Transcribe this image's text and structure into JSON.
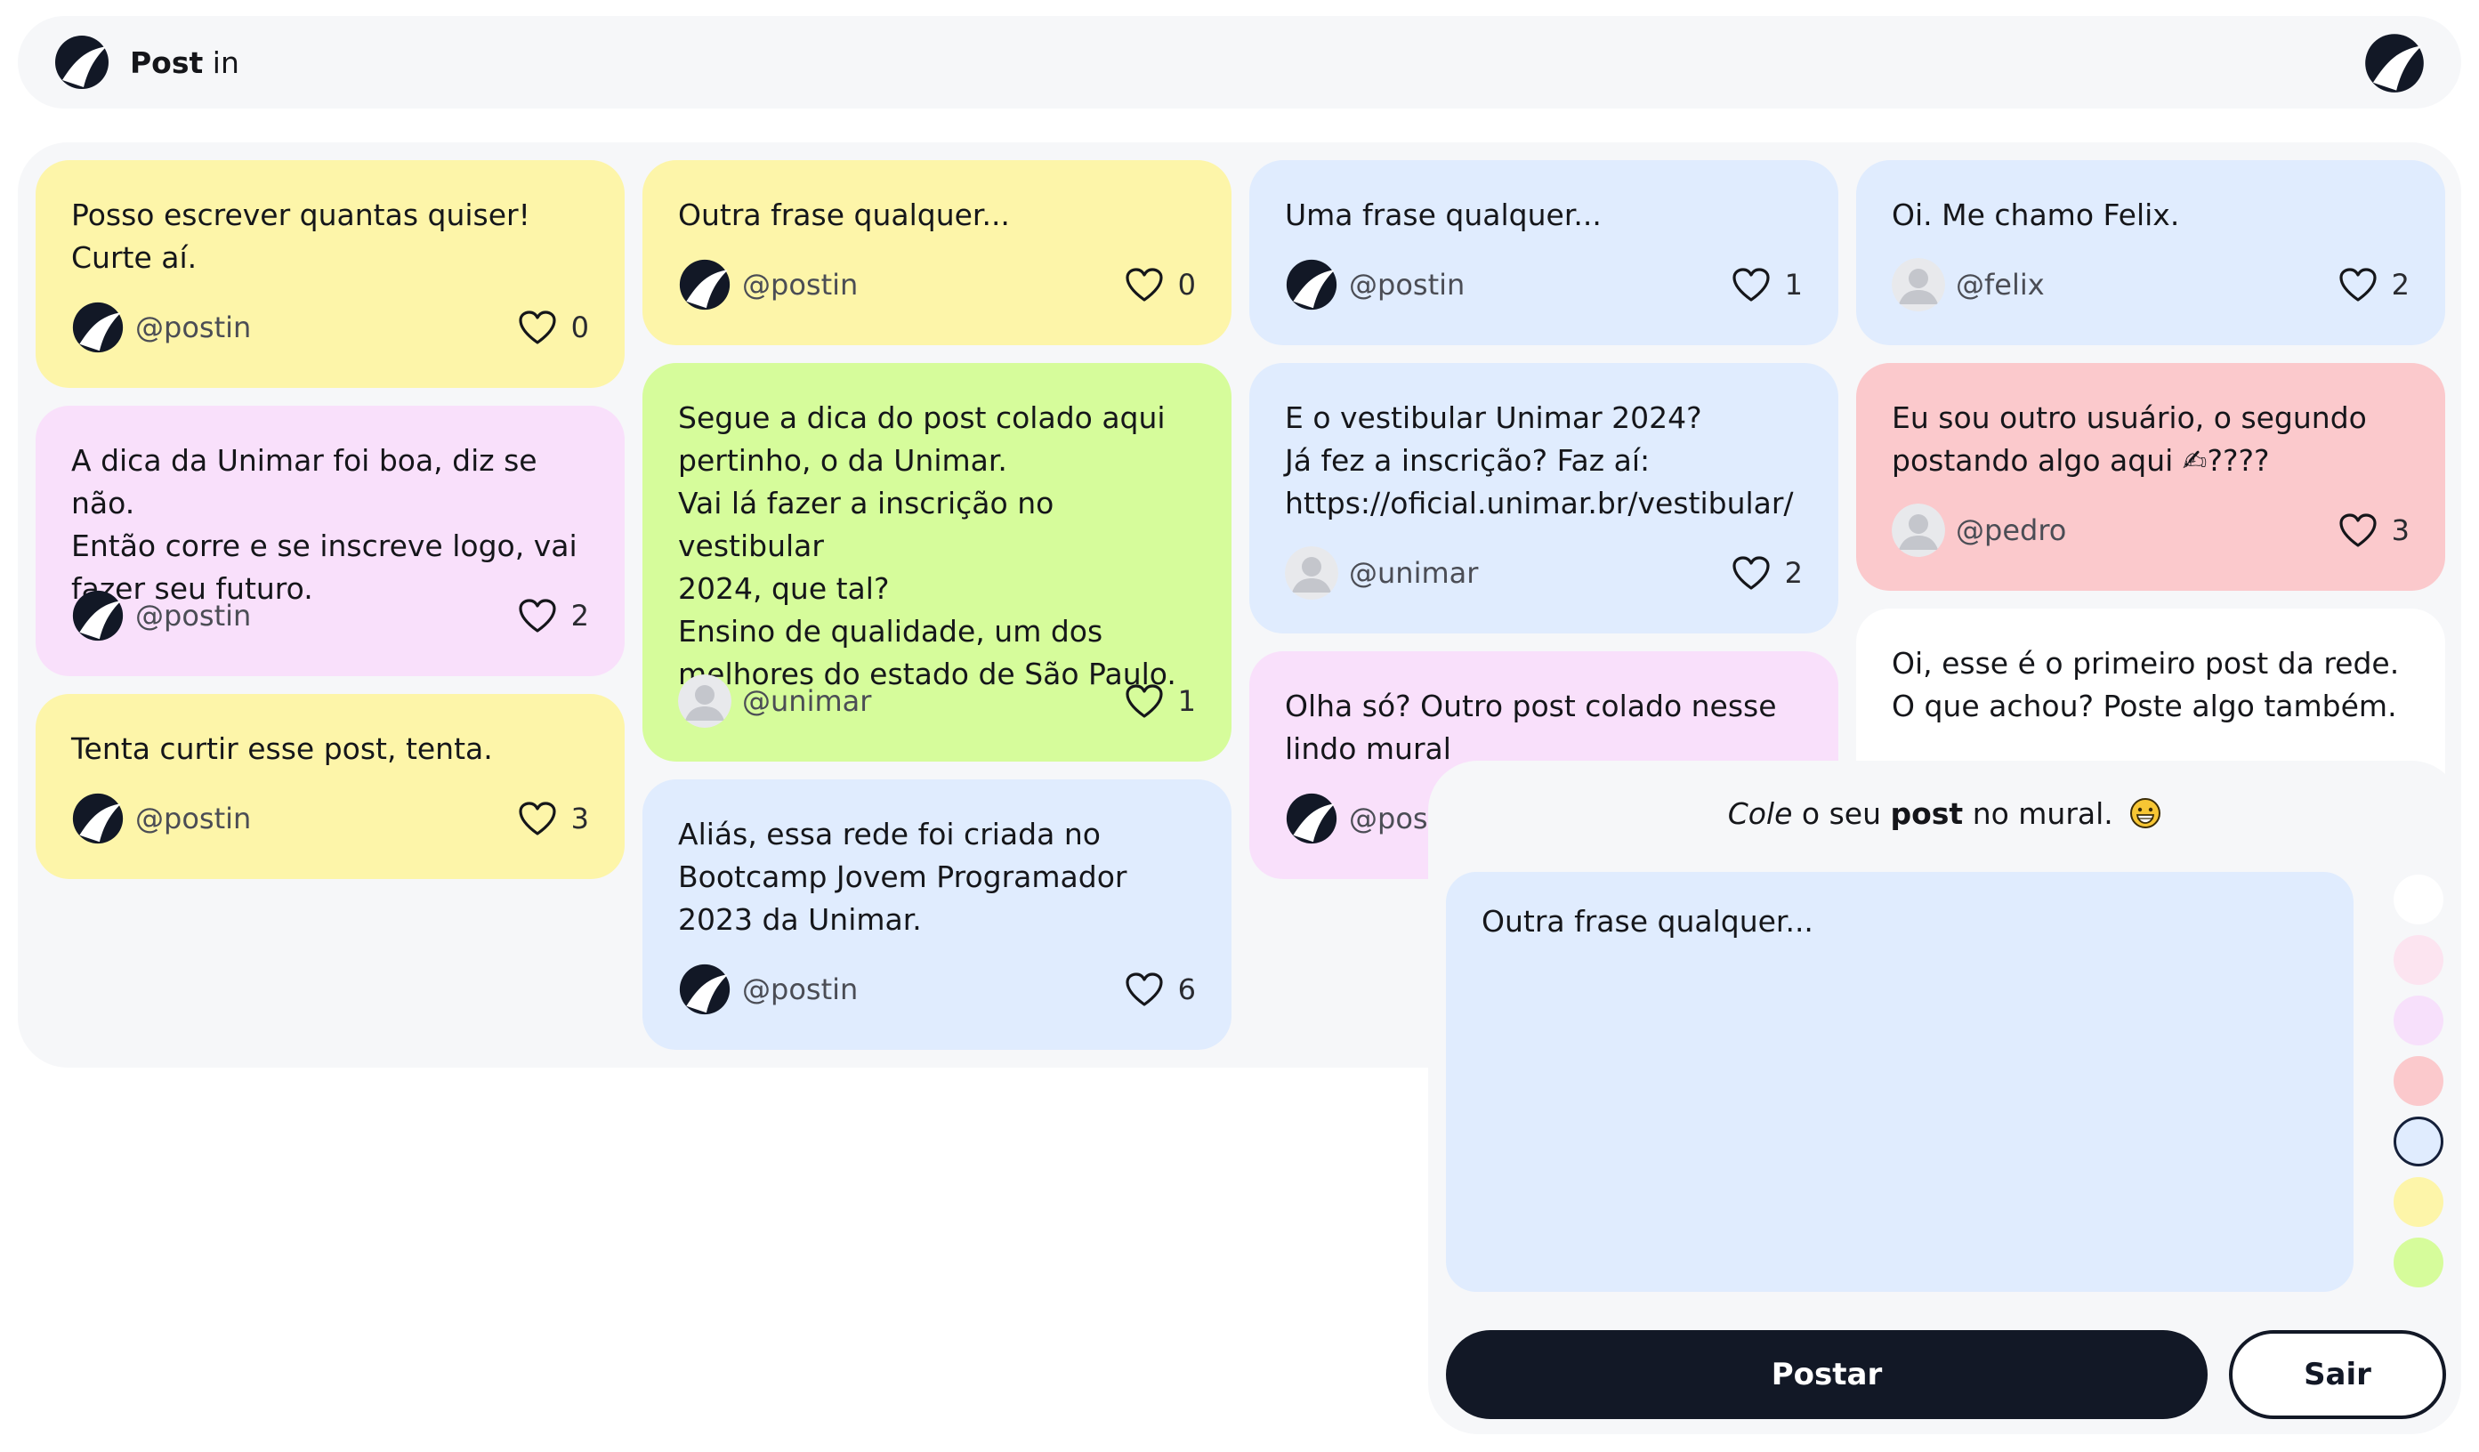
{
  "header": {
    "brand_bold": "Post",
    "brand_rest": " in",
    "logo_icon": "postin-logo-icon"
  },
  "colors": {
    "yellow": "#fdf5a9",
    "pink": "#f9e0fb",
    "green": "#d6fc9b",
    "blue": "#e0ecfe",
    "red": "#fbc9cc",
    "white": "#ffffff",
    "dark": "#121826"
  },
  "posts": [
    {
      "text": "Posso escrever quantas quiser!\nCurte aí.",
      "handle": "@postin",
      "likes": "0",
      "color": "yellow",
      "avatar": "postin-logo"
    },
    {
      "text": "A dica da Unimar foi boa, diz se não.\nEntão corre e se inscreve logo, vai\nfazer seu futuro.",
      "handle": "@postin",
      "likes": "2",
      "color": "pink",
      "avatar": "postin-logo"
    },
    {
      "text": "Tenta curtir esse post, tenta.",
      "handle": "@postin",
      "likes": "3",
      "color": "yellow",
      "avatar": "postin-logo"
    },
    {
      "text": "Outra frase qualquer...",
      "handle": "@postin",
      "likes": "0",
      "color": "yellow",
      "avatar": "postin-logo"
    },
    {
      "text": "Segue a dica do post colado aqui\npertinho, o da Unimar.\nVai lá fazer a inscrição no vestibular\n2024, que tal?\nEnsino de qualidade, um dos\nmelhores do estado de São Paulo.",
      "handle": "@unimar",
      "likes": "1",
      "color": "green",
      "avatar": "default-user"
    },
    {
      "text": "Aliás, essa rede foi criada no\nBootcamp Jovem Programador\n2023 da Unimar.",
      "handle": "@postin",
      "likes": "6",
      "color": "blue",
      "avatar": "postin-logo"
    },
    {
      "text": "Uma frase qualquer...",
      "handle": "@postin",
      "likes": "1",
      "color": "blue",
      "avatar": "postin-logo"
    },
    {
      "text": "E o vestibular Unimar 2024?\nJá fez a inscrição? Faz aí:\nhttps://oficial.unimar.br/vestibular/",
      "handle": "@unimar",
      "likes": "2",
      "color": "blue",
      "avatar": "default-user"
    },
    {
      "text": "Olha só? Outro post colado nesse\nlindo mural",
      "handle": "@postin",
      "likes": "",
      "color": "pink",
      "avatar": "postin-logo"
    },
    {
      "text": "Oi. Me chamo Felix.",
      "handle": "@felix",
      "likes": "2",
      "color": "blue",
      "avatar": "default-user"
    },
    {
      "text": "Eu sou outro usuário, o segundo\npostando algo aqui ✍????",
      "handle": "@pedro",
      "likes": "3",
      "color": "red",
      "avatar": "default-user"
    },
    {
      "text": "Oi, esse é o primeiro post da rede.\nO que achou? Poste algo também.",
      "handle": "",
      "likes": "",
      "color": "white",
      "avatar": ""
    }
  ],
  "composer": {
    "title_italic": "Cole",
    "title_mid": " o seu ",
    "title_bold": "post",
    "title_end": " no mural.",
    "title_emoji": "grinning-face-icon",
    "text_value": "Outra frase qualquer...",
    "swatches": [
      "#ffffff",
      "#fce4f0",
      "#f7e0fb",
      "#fbc9cc",
      "#e0ecfe",
      "#fdf5a9",
      "#d6fc9b"
    ],
    "selected_swatch": 4,
    "post_button": "Postar",
    "exit_button": "Sair"
  }
}
